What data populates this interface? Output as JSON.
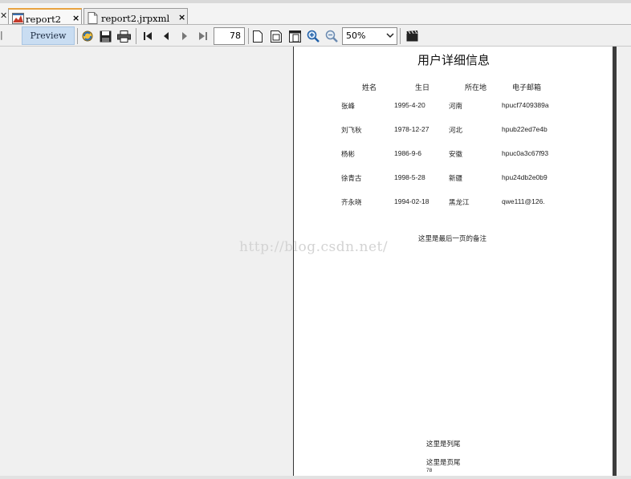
{
  "tabs": [
    {
      "label": "report2",
      "active": true
    },
    {
      "label": "report2.jrpxml",
      "active": false
    }
  ],
  "tab_close_glyph": "×",
  "toolbar": {
    "preview_label": "Preview",
    "page_number": "78",
    "zoom": "50%",
    "icons": [
      "reload-icon",
      "save-icon",
      "print-icon",
      "first-page-icon",
      "prev-page-icon",
      "next-page-icon",
      "last-page-icon",
      "actual-size-icon",
      "fit-page-icon",
      "fit-width-icon",
      "zoom-in-icon",
      "zoom-out-icon",
      "export-icon"
    ]
  },
  "report": {
    "title": "用户详细信息",
    "columns": [
      "姓名",
      "生日",
      "所在地",
      "电子邮箱"
    ],
    "rows": [
      {
        "name": "张峰",
        "birthday": "1995-4-20",
        "location": "河南",
        "email": "hpucf7409389a"
      },
      {
        "name": "刘飞秋",
        "birthday": "1978-12-27",
        "location": "河北",
        "email": "hpub22ed7e4b"
      },
      {
        "name": "杨彬",
        "birthday": "1986-9-6",
        "location": "安徽",
        "email": "hpuc0a3c67f93"
      },
      {
        "name": "徐青古",
        "birthday": "1998-5-28",
        "location": "新疆",
        "email": "hpu24db2e0b9"
      },
      {
        "name": "齐永晓",
        "birthday": "1994-02-18",
        "location": "黑龙江",
        "email": "qwe111@126."
      }
    ],
    "last_page_note": "这里是最后一页的备注",
    "column_footer": "这里是列尾",
    "page_footer": "这里是页尾",
    "page_number": "78"
  },
  "watermark": "http://blog.csdn.net/",
  "colors": {
    "accent_tab": "#e8a340",
    "preview_button": "#c9ddf2",
    "page_bg": "#ffffff",
    "viewer_bg": "#f0f0f0"
  }
}
